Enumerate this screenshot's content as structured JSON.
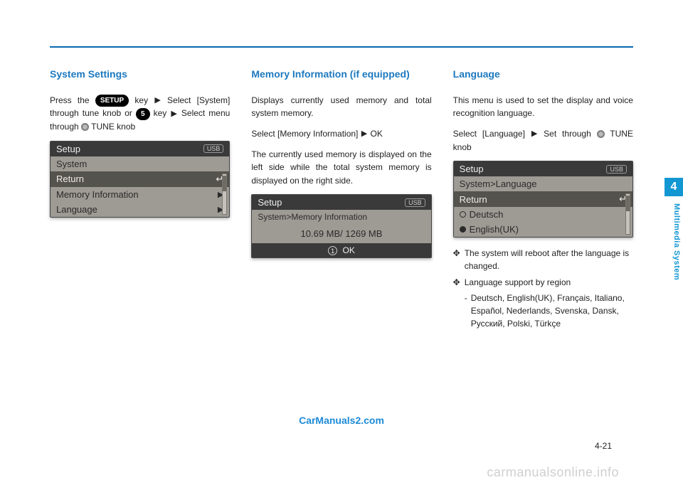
{
  "sidebar": {
    "chapter_number": "4",
    "chapter_title": "Multimedia System"
  },
  "footer": {
    "link": "CarManuals2.com",
    "page": "4-21",
    "watermark": "carmanualsonline.info"
  },
  "col1": {
    "heading": "System Settings",
    "p1_a": "Press the ",
    "p1_setup": "SETUP",
    "p1_b": " key",
    "p1_c": "Select [System] through tune knob or ",
    "p1_five": "5",
    "p1_d": " key",
    "p1_e": "Select menu through ",
    "p1_f": " TUNE knob",
    "screen": {
      "top": "Setup",
      "usb": "USB",
      "sub": "System",
      "row_return": "Return",
      "row_memory": "Memory Information",
      "row_language": "Language"
    }
  },
  "col2": {
    "heading": "Memory Information (if equipped)",
    "p1": "Displays currently used memory and total system memory.",
    "p2_a": "Select [Memory Information]",
    "p2_b": "OK",
    "p3": "The currently used memory is displayed on the left side while the total system memory is displayed on the right side.",
    "screen": {
      "top": "Setup",
      "usb": "USB",
      "sub": "System>Memory Information",
      "value": "10.69 MB/ 1269 MB",
      "ok": "OK"
    }
  },
  "col3": {
    "heading": "Language",
    "p1": "This menu is used to set the display and voice recognition language.",
    "p2_a": "Select [Language]",
    "p2_b": "Set through ",
    "p2_c": "TUNE knob",
    "screen": {
      "top": "Setup",
      "usb": "USB",
      "sub": "System>Language",
      "row_return": "Return",
      "row_deutsch": "Deutsch",
      "row_english": "English(UK)"
    },
    "b1": "The system will reboot after the language is changed.",
    "b2": "Language support by region",
    "b2sub": "Deutsch, English(UK), Français, Italiano, Español, Nederlands, Svenska, Dansk, Русский, Polski, Türkçe"
  }
}
